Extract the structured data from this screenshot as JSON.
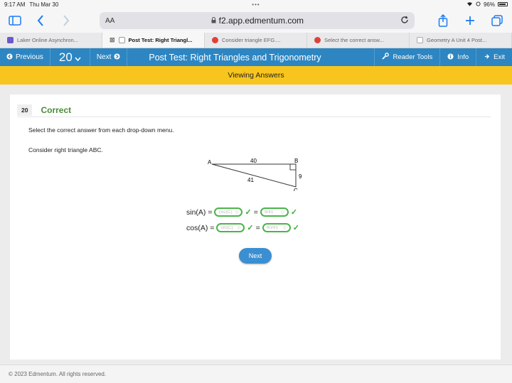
{
  "status_bar": {
    "time": "9:17 AM",
    "date": "Thu Mar 30",
    "dots": "•••",
    "battery": "96%"
  },
  "browser": {
    "aa_label": "AA",
    "url": "f2.app.edmentum.com"
  },
  "tabs": [
    {
      "label": "Laker Online Asynchron...",
      "favicon": "purple"
    },
    {
      "label": "Post Test: Right Triangl...",
      "favicon": "gray",
      "active": true
    },
    {
      "label": "Consider triangle EFG....",
      "favicon": "red"
    },
    {
      "label": "Select the correct answ...",
      "favicon": "red"
    },
    {
      "label": "Geometry A Unit 4 Post...",
      "favicon": "blue"
    }
  ],
  "app_bar": {
    "previous_label": "Previous",
    "question_number": "20",
    "next_label": "Next",
    "title": "Post Test: Right Triangles and Trigonometry",
    "reader_tools_label": "Reader Tools",
    "info_label": "Info",
    "exit_label": "Exit"
  },
  "banner": "Viewing Answers",
  "question": {
    "number": "20",
    "status": "Correct",
    "instruction": "Select the correct answer from each drop-down menu.",
    "prompt": "Consider right triangle ABC.",
    "triangle": {
      "vertex_a": "A",
      "vertex_b": "B",
      "vertex_c": "C",
      "side_ab": "40",
      "side_bc": "9",
      "side_ac": "41"
    },
    "equations": [
      {
        "lhs": "sin(A) =",
        "answer1": "cos(C)",
        "eq": "=",
        "answer2": "9/41"
      },
      {
        "lhs": "cos(A) =",
        "answer1": "sin(C)",
        "eq": "=",
        "answer2": "40/41"
      }
    ],
    "next_button": "Next"
  },
  "footer": "© 2023 Edmentum. All rights reserved.",
  "colors": {
    "app_bar": "#2d86c2",
    "banner": "#f7c51e",
    "correct": "#4a8b3a",
    "check": "#3aad3a"
  }
}
